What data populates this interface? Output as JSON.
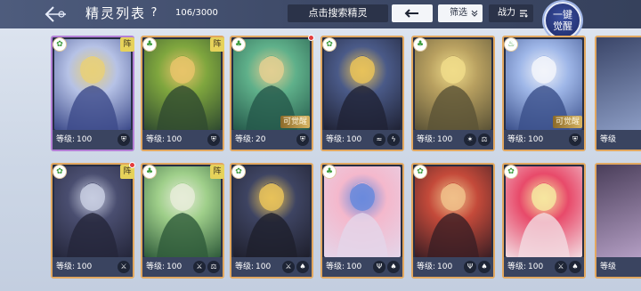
{
  "header": {
    "title": "精灵列表",
    "help": "?",
    "count": "106/3000",
    "search_placeholder": "点击搜索精灵",
    "filter_label": "筛选",
    "power_label": "战力",
    "awaken_line1": "一键",
    "awaken_line2": "觉醒"
  },
  "colors": {
    "topbar": "#3f4b69",
    "card_gold_border": "#e2a860",
    "card_purple_border": "#b47fd6",
    "zhen_badge": "#e6d25a",
    "awaken_badge": "#d7b461"
  },
  "cards": [
    {
      "row": 0,
      "level_label": "等级:",
      "level": "100",
      "element": "✿",
      "zhen": "阵",
      "awake": "",
      "border": "purple",
      "icons": [
        "shield"
      ],
      "art": [
        "#3c4a8a",
        "#b6c2e6",
        "#e8d07a"
      ]
    },
    {
      "row": 0,
      "level_label": "等级:",
      "level": "100",
      "element": "♣",
      "zhen": "阵",
      "awake": "",
      "border": "gold",
      "icons": [
        "shield"
      ],
      "art": [
        "#2f4a30",
        "#7fa63e",
        "#e8c46a"
      ]
    },
    {
      "row": 0,
      "level_label": "等级:",
      "level": "20",
      "element": "♣",
      "zhen": "",
      "awake": "可觉醒",
      "border": "gold",
      "icons": [
        "shield"
      ],
      "art": [
        "#24584a",
        "#5fb08a",
        "#e2cf92"
      ]
    },
    {
      "row": 0,
      "level_label": "等级:",
      "level": "100",
      "element": "✿",
      "zhen": "",
      "awake": "",
      "border": "gold",
      "icons": [
        "wind",
        "bolt"
      ],
      "art": [
        "#1f2234",
        "#4a5a88",
        "#e8c25a"
      ]
    },
    {
      "row": 0,
      "level_label": "等级:",
      "level": "100",
      "element": "♣",
      "zhen": "",
      "awake": "",
      "border": "gold",
      "icons": [
        "star",
        "scale"
      ],
      "art": [
        "#5a5236",
        "#b8a060",
        "#f0dc8a"
      ]
    },
    {
      "row": 0,
      "level_label": "等级:",
      "level": "100",
      "element": "♨",
      "zhen": "",
      "awake": "可觉醒",
      "border": "gold",
      "icons": [
        "shield"
      ],
      "art": [
        "#3a4f8a",
        "#9fb7e8",
        "#f2f4fa"
      ]
    },
    {
      "row": 1,
      "level_label": "等级:",
      "level": "100",
      "element": "✿",
      "zhen": "阵",
      "awake": "",
      "border": "gold",
      "icons": [
        "sword"
      ],
      "art": [
        "#24263a",
        "#4a4e70",
        "#c7cce0"
      ]
    },
    {
      "row": 1,
      "level_label": "等级:",
      "level": "100",
      "element": "♣",
      "zhen": "阵",
      "awake": "",
      "border": "gold",
      "icons": [
        "sword",
        "scale"
      ],
      "art": [
        "#2e5a3a",
        "#9fcf8a",
        "#e6ecd8"
      ]
    },
    {
      "row": 1,
      "level_label": "等级:",
      "level": "100",
      "element": "✿",
      "zhen": "",
      "awake": "",
      "border": "gold",
      "icons": [
        "sword",
        "hat"
      ],
      "art": [
        "#1e1f2c",
        "#3e4462",
        "#e8c25a"
      ]
    },
    {
      "row": 1,
      "level_label": "等级:",
      "level": "100",
      "element": "♣",
      "zhen": "",
      "awake": "",
      "border": "gold",
      "icons": [
        "trident",
        "hat"
      ],
      "art": [
        "#e4d6ea",
        "#f4b8cc",
        "#6a8adc"
      ]
    },
    {
      "row": 1,
      "level_label": "等级:",
      "level": "100",
      "element": "✿",
      "zhen": "",
      "awake": "",
      "border": "gold",
      "icons": [
        "trident",
        "hat"
      ],
      "art": [
        "#3a1e24",
        "#c44a3a",
        "#f0c08a"
      ]
    },
    {
      "row": 1,
      "level_label": "等级:",
      "level": "100",
      "element": "✿",
      "zhen": "",
      "awake": "",
      "border": "gold",
      "icons": [
        "sword",
        "hat"
      ],
      "art": [
        "#f2dce2",
        "#e84a6a",
        "#f6e6a0"
      ]
    }
  ],
  "edge_cards": [
    {
      "level_label": "等级"
    },
    {
      "level_label": "等级"
    }
  ]
}
